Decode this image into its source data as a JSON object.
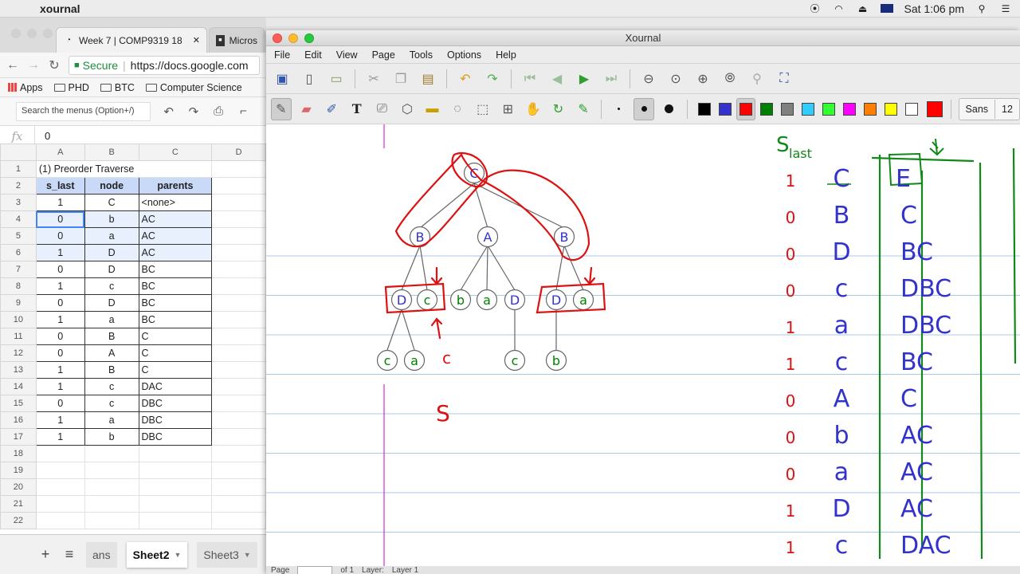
{
  "menubar": {
    "app_name": "xournal",
    "clock": "Sat 1:06 pm"
  },
  "chrome": {
    "tabs": [
      {
        "label": "Week 7 | COMP9319 18",
        "close": "✕"
      },
      {
        "label": "Micros"
      }
    ],
    "url_secure": "Secure",
    "url": "https://docs.google.com",
    "bookmarks": [
      "Apps",
      "PHD",
      "BTC",
      "Computer Science"
    ]
  },
  "sheets": {
    "menu_search_placeholder": "Search the menus (Option+/)",
    "fx": "fx",
    "formula_value": "0",
    "columns": [
      "A",
      "B",
      "C",
      "D"
    ],
    "title": "(1) Preorder Traverse",
    "headers": [
      "s_last",
      "node",
      "parents"
    ],
    "rows": [
      [
        "1",
        "C",
        "<none>"
      ],
      [
        "0",
        "b",
        "AC"
      ],
      [
        "0",
        "a",
        "AC"
      ],
      [
        "1",
        "D",
        "AC"
      ],
      [
        "0",
        "D",
        "BC"
      ],
      [
        "1",
        "c",
        "BC"
      ],
      [
        "0",
        "D",
        "BC"
      ],
      [
        "1",
        "a",
        "BC"
      ],
      [
        "0",
        "B",
        "C"
      ],
      [
        "0",
        "A",
        "C"
      ],
      [
        "1",
        "B",
        "C"
      ],
      [
        "1",
        "c",
        "DAC"
      ],
      [
        "0",
        "c",
        "DBC"
      ],
      [
        "1",
        "a",
        "DBC"
      ],
      [
        "1",
        "b",
        "DBC"
      ]
    ],
    "row_numbers": [
      "1",
      "2",
      "3",
      "4",
      "5",
      "6",
      "7",
      "8",
      "9",
      "10",
      "11",
      "12",
      "13",
      "14",
      "15",
      "16",
      "17",
      "18",
      "19",
      "20",
      "21",
      "22"
    ],
    "sheet_tabs": [
      "ans",
      "Sheet2",
      "Sheet3"
    ],
    "active_sheet": "Sheet2"
  },
  "xournal": {
    "title": "Xournal",
    "menu": [
      "File",
      "Edit",
      "View",
      "Page",
      "Tools",
      "Options",
      "Help"
    ],
    "font_name": "Sans",
    "font_size": "12",
    "colors": [
      "#000000",
      "#3333cc",
      "#ff0000",
      "#008000",
      "#808080",
      "#33ccff",
      "#33ff33",
      "#ff00ff",
      "#ff8000",
      "#ffff00",
      "#ffffff"
    ],
    "current_color": "#ff0000",
    "status": {
      "page_label": "Page",
      "of_label": "of 1",
      "layer_label": "Layer:",
      "layer_value": "Layer 1"
    }
  },
  "drawing": {
    "tree_nodes": [
      {
        "label": "C",
        "color": "#3333cc"
      },
      {
        "label": "B",
        "color": "#3333cc"
      },
      {
        "label": "A",
        "color": "#3333cc"
      },
      {
        "label": "B",
        "color": "#3333cc"
      },
      {
        "label": "D",
        "color": "#3333cc"
      },
      {
        "label": "c",
        "color": "#008000"
      },
      {
        "label": "b",
        "color": "#008000"
      },
      {
        "label": "a",
        "color": "#008000"
      },
      {
        "label": "D",
        "color": "#3333cc"
      },
      {
        "label": "D",
        "color": "#3333cc"
      },
      {
        "label": "a",
        "color": "#008000"
      },
      {
        "label": "c",
        "color": "#008000"
      },
      {
        "label": "a",
        "color": "#008000"
      },
      {
        "label": "c",
        "color": "#008000"
      },
      {
        "label": "b",
        "color": "#008000"
      }
    ],
    "red_notes": [
      "c",
      "S"
    ],
    "table_header": {
      "s": "S",
      "s_sub": "last",
      "e": "E"
    },
    "table_rows": [
      {
        "s": "1",
        "node": "C",
        "parents": "E"
      },
      {
        "s": "0",
        "node": "B",
        "parents": "C"
      },
      {
        "s": "0",
        "node": "D",
        "parents": "BC"
      },
      {
        "s": "0",
        "node": "c",
        "parents": "DBC"
      },
      {
        "s": "1",
        "node": "a",
        "parents": "DBC"
      },
      {
        "s": "1",
        "node": "c",
        "parents": "BC"
      },
      {
        "s": "0",
        "node": "A",
        "parents": "C"
      },
      {
        "s": "0",
        "node": "b",
        "parents": "AC"
      },
      {
        "s": "0",
        "node": "a",
        "parents": "AC"
      },
      {
        "s": "1",
        "node": "D",
        "parents": "AC"
      },
      {
        "s": "1",
        "node": "c",
        "parents": "DAC"
      }
    ]
  }
}
